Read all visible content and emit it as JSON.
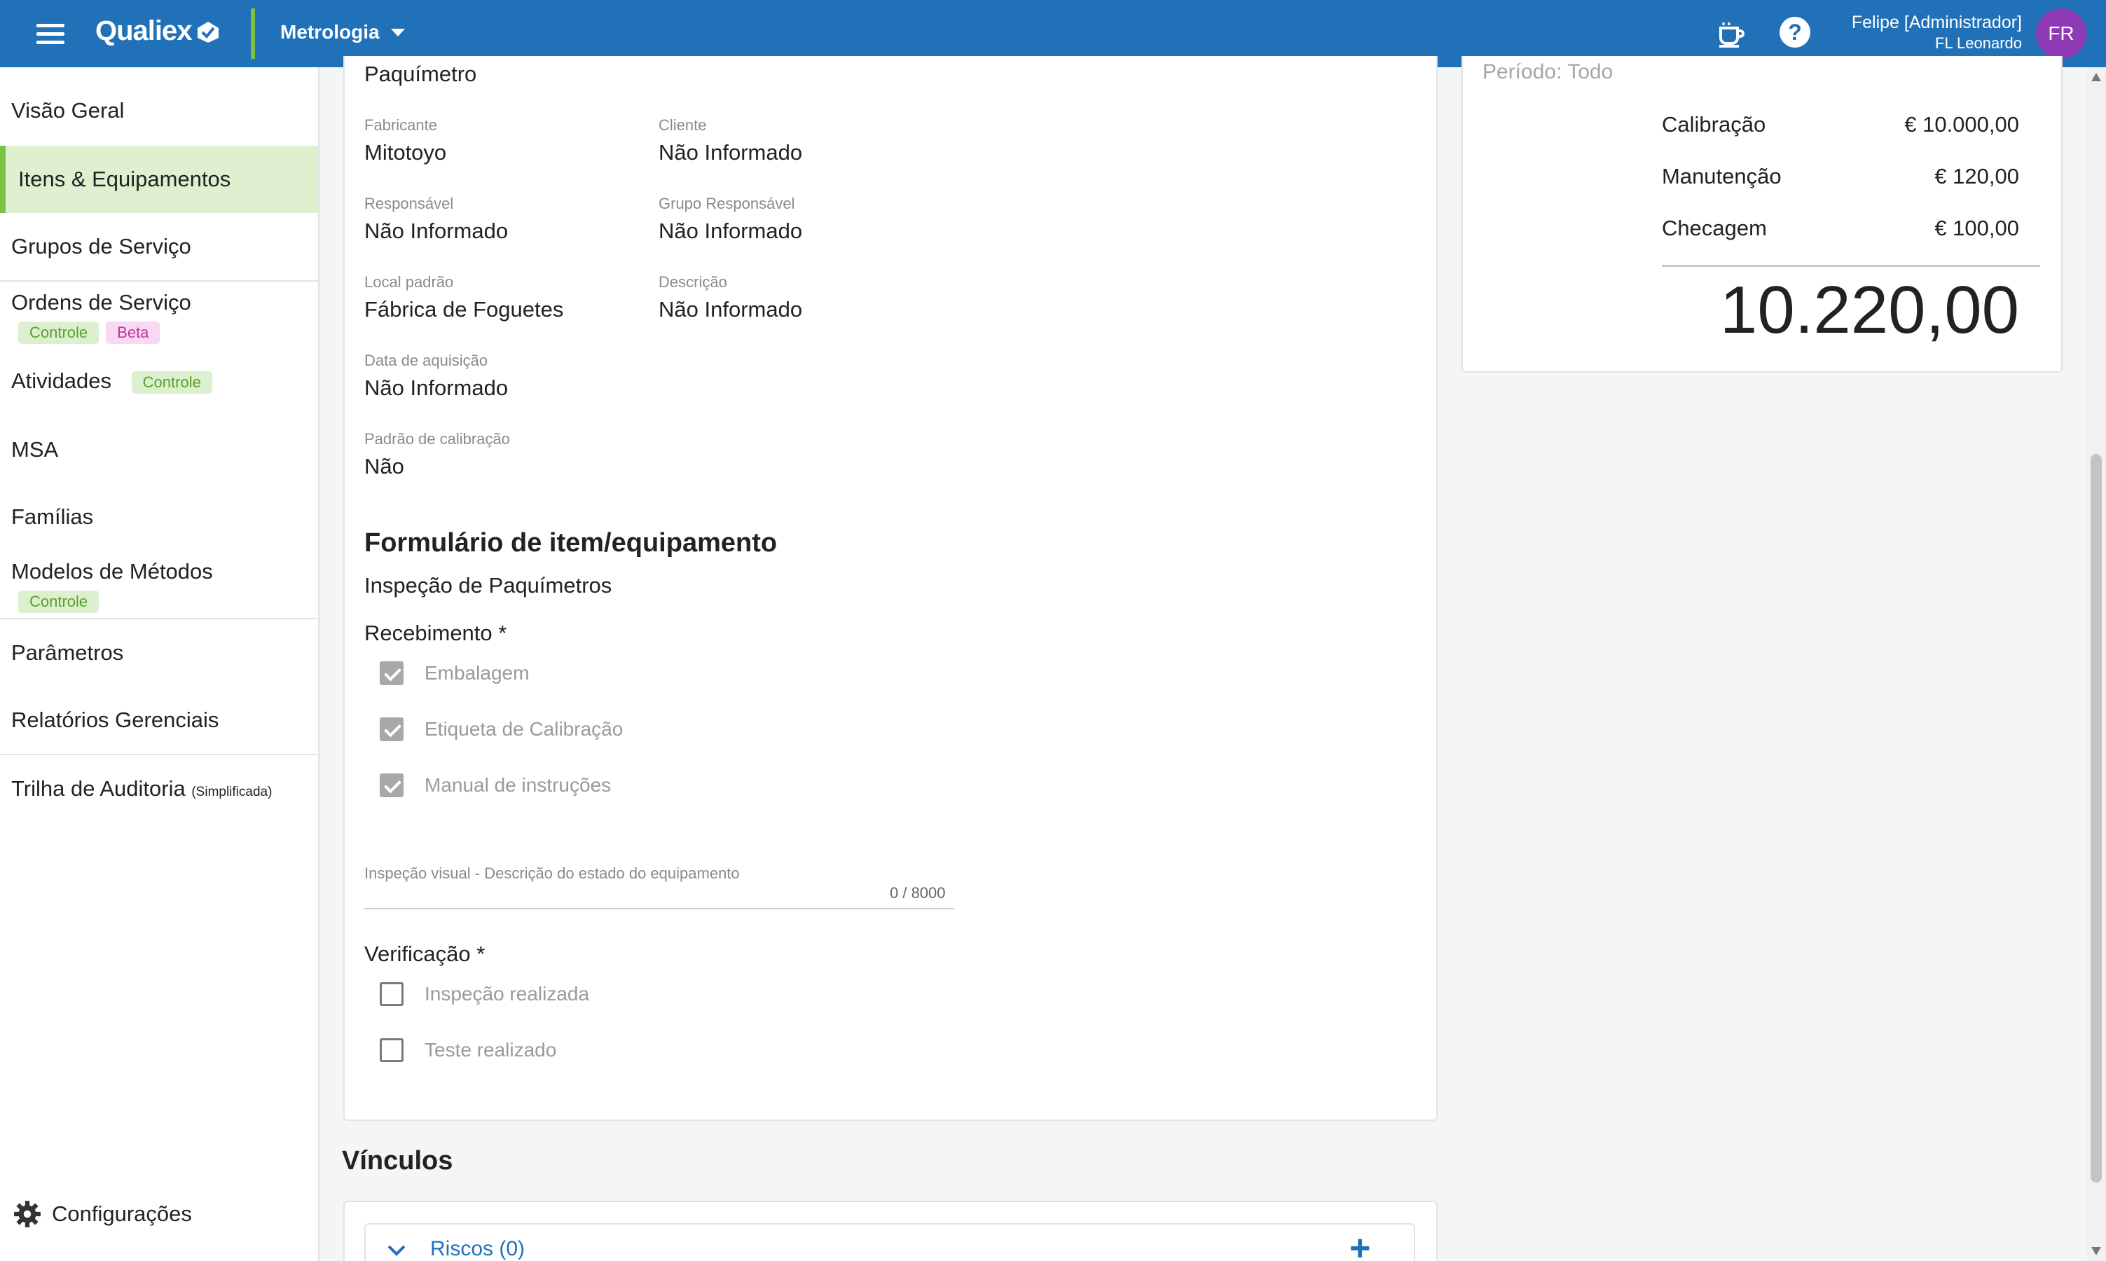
{
  "topbar": {
    "logo": "Qualiex",
    "module": "Metrologia",
    "user_name": "Felipe [Administrador]",
    "user_org": "FL Leonardo",
    "avatar_initials": "FR",
    "help_glyph": "?"
  },
  "sidebar": {
    "items": [
      {
        "label": "Visão Geral"
      },
      {
        "label": "Itens & Equipamentos"
      },
      {
        "label": "Grupos de Serviço"
      },
      {
        "label": "Ordens de Serviço",
        "badges": [
          "Controle",
          "Beta"
        ]
      },
      {
        "label": "Atividades",
        "badges": [
          "Controle"
        ]
      },
      {
        "label": "MSA"
      },
      {
        "label": "Famílias"
      },
      {
        "label": "Modelos de Métodos",
        "badges": [
          "Controle"
        ]
      },
      {
        "label": "Parâmetros"
      },
      {
        "label": "Relatórios Gerenciais"
      },
      {
        "label": "Trilha de Auditoria",
        "note": "(Simplificada)"
      }
    ],
    "settings_label": "Configurações"
  },
  "details": {
    "item_name": "Paquímetro",
    "fields": [
      {
        "label": "Fabricante",
        "value": "Mitotoyo"
      },
      {
        "label": "Cliente",
        "value": "Não Informado"
      },
      {
        "label": "Responsável",
        "value": "Não Informado"
      },
      {
        "label": "Grupo Responsável",
        "value": "Não Informado"
      },
      {
        "label": "Local padrão",
        "value": "Fábrica de Foguetes"
      },
      {
        "label": "Descrição",
        "value": "Não Informado"
      },
      {
        "label": "Data de aquisição",
        "value": "Não Informado"
      },
      {
        "label": "Padrão de calibração",
        "value": "Não"
      }
    ]
  },
  "form": {
    "title": "Formulário de item/equipamento",
    "form_name": "Inspeção de Paquímetros",
    "receiving_label": "Recebimento *",
    "receiving_options": [
      {
        "label": "Embalagem",
        "checked": true
      },
      {
        "label": "Etiqueta de Calibração",
        "checked": true
      },
      {
        "label": "Manual de instruções",
        "checked": true
      }
    ],
    "visual_label": "Inspeção visual - Descrição do estado do equipamento",
    "visual_counter": "0 / 8000",
    "verification_label": "Verificação *",
    "verification_options": [
      {
        "label": "Inspeção realizada",
        "checked": false
      },
      {
        "label": "Teste realizado",
        "checked": false
      }
    ]
  },
  "links": {
    "title": "Vínculos",
    "risks_label": "Riscos (0)",
    "add_glyph": "+"
  },
  "costs": {
    "period_label": "Período:",
    "period_value": "Todo",
    "rows": [
      {
        "label": "Calibração",
        "value": "€ 10.000,00"
      },
      {
        "label": "Manutenção",
        "value": "€ 120,00"
      },
      {
        "label": "Checagem",
        "value": "€ 100,00"
      }
    ],
    "total": "10.220,00"
  },
  "colors": {
    "topbar": "#2171b8",
    "accent_green": "#7cc242",
    "avatar": "#8e3ab5",
    "link_blue": "#2171b8"
  }
}
